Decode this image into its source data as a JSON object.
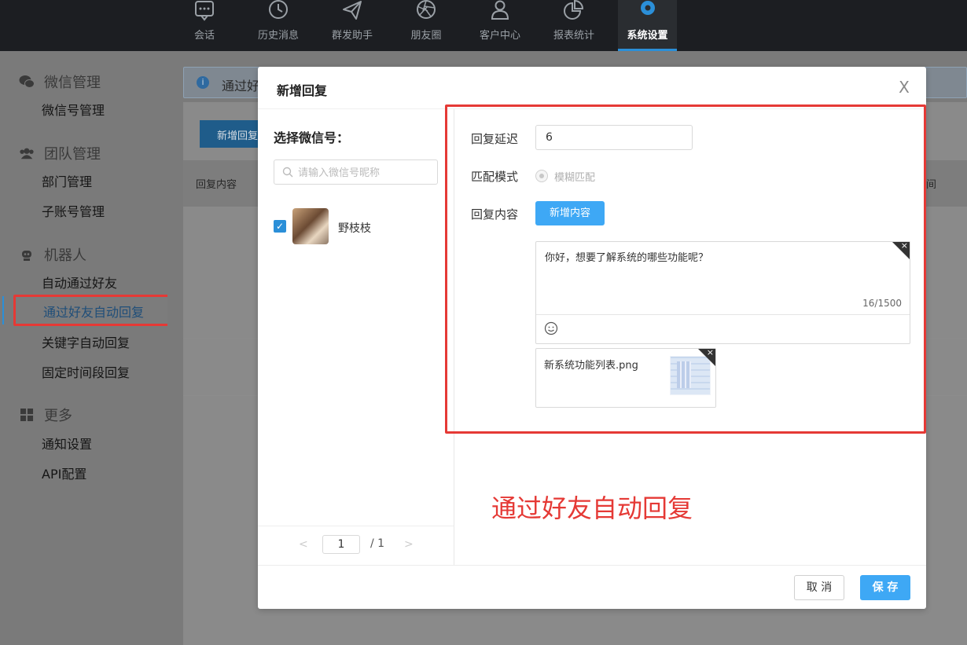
{
  "topnav": {
    "items": [
      {
        "label": "会话",
        "icon": "chat-icon"
      },
      {
        "label": "历史消息",
        "icon": "clock-icon"
      },
      {
        "label": "群发助手",
        "icon": "paper-plane-icon"
      },
      {
        "label": "朋友圈",
        "icon": "aperture-icon"
      },
      {
        "label": "客户中心",
        "icon": "user-icon"
      },
      {
        "label": "报表统计",
        "icon": "pie-chart-icon"
      },
      {
        "label": "系统设置",
        "icon": "gear-icon",
        "active": true
      }
    ]
  },
  "sidebar": {
    "sections": [
      {
        "title": "微信管理",
        "icon": "wechat-icon",
        "items": [
          "微信号管理"
        ]
      },
      {
        "title": "团队管理",
        "icon": "team-icon",
        "items": [
          "部门管理",
          "子账号管理"
        ]
      },
      {
        "title": "机器人",
        "icon": "robot-icon",
        "items": [
          "自动通过好友",
          "通过好友自动回复",
          "关键字自动回复",
          "固定时间段回复"
        ]
      },
      {
        "title": "更多",
        "icon": "grid-icon",
        "items": [
          "通知设置",
          "API配置"
        ]
      }
    ],
    "selected": "通过好友自动回复"
  },
  "background": {
    "banner_text": "通过好",
    "add_button": "新增回复",
    "col_first": "回复内容",
    "col_last": "间"
  },
  "modal": {
    "title": "新增回复",
    "close": "X",
    "left": {
      "heading": "选择微信号：",
      "search_placeholder": "请输入微信号昵称",
      "account_name": "野枝枝",
      "checked_mark": "✓",
      "pager": {
        "prev": "<",
        "page": "1",
        "total": "/ 1",
        "next": ">"
      }
    },
    "form": {
      "delay_label": "回复延迟",
      "delay_value": "6",
      "match_label": "匹配模式",
      "match_option": "模糊匹配",
      "content_label": "回复内容",
      "add_content_button": "新增内容",
      "text_content": "你好，想要了解系统的哪些功能呢？",
      "char_count": "16/1500",
      "remove_mark": "×",
      "file_name": "新系统功能列表.png"
    },
    "annotation": "通过好友自动回复",
    "cancel_button": "取 消",
    "save_button": "保 存"
  },
  "colors": {
    "accent": "#3ea8f5",
    "highlight_red": "#e53935",
    "topbar": "#1c1e22"
  }
}
